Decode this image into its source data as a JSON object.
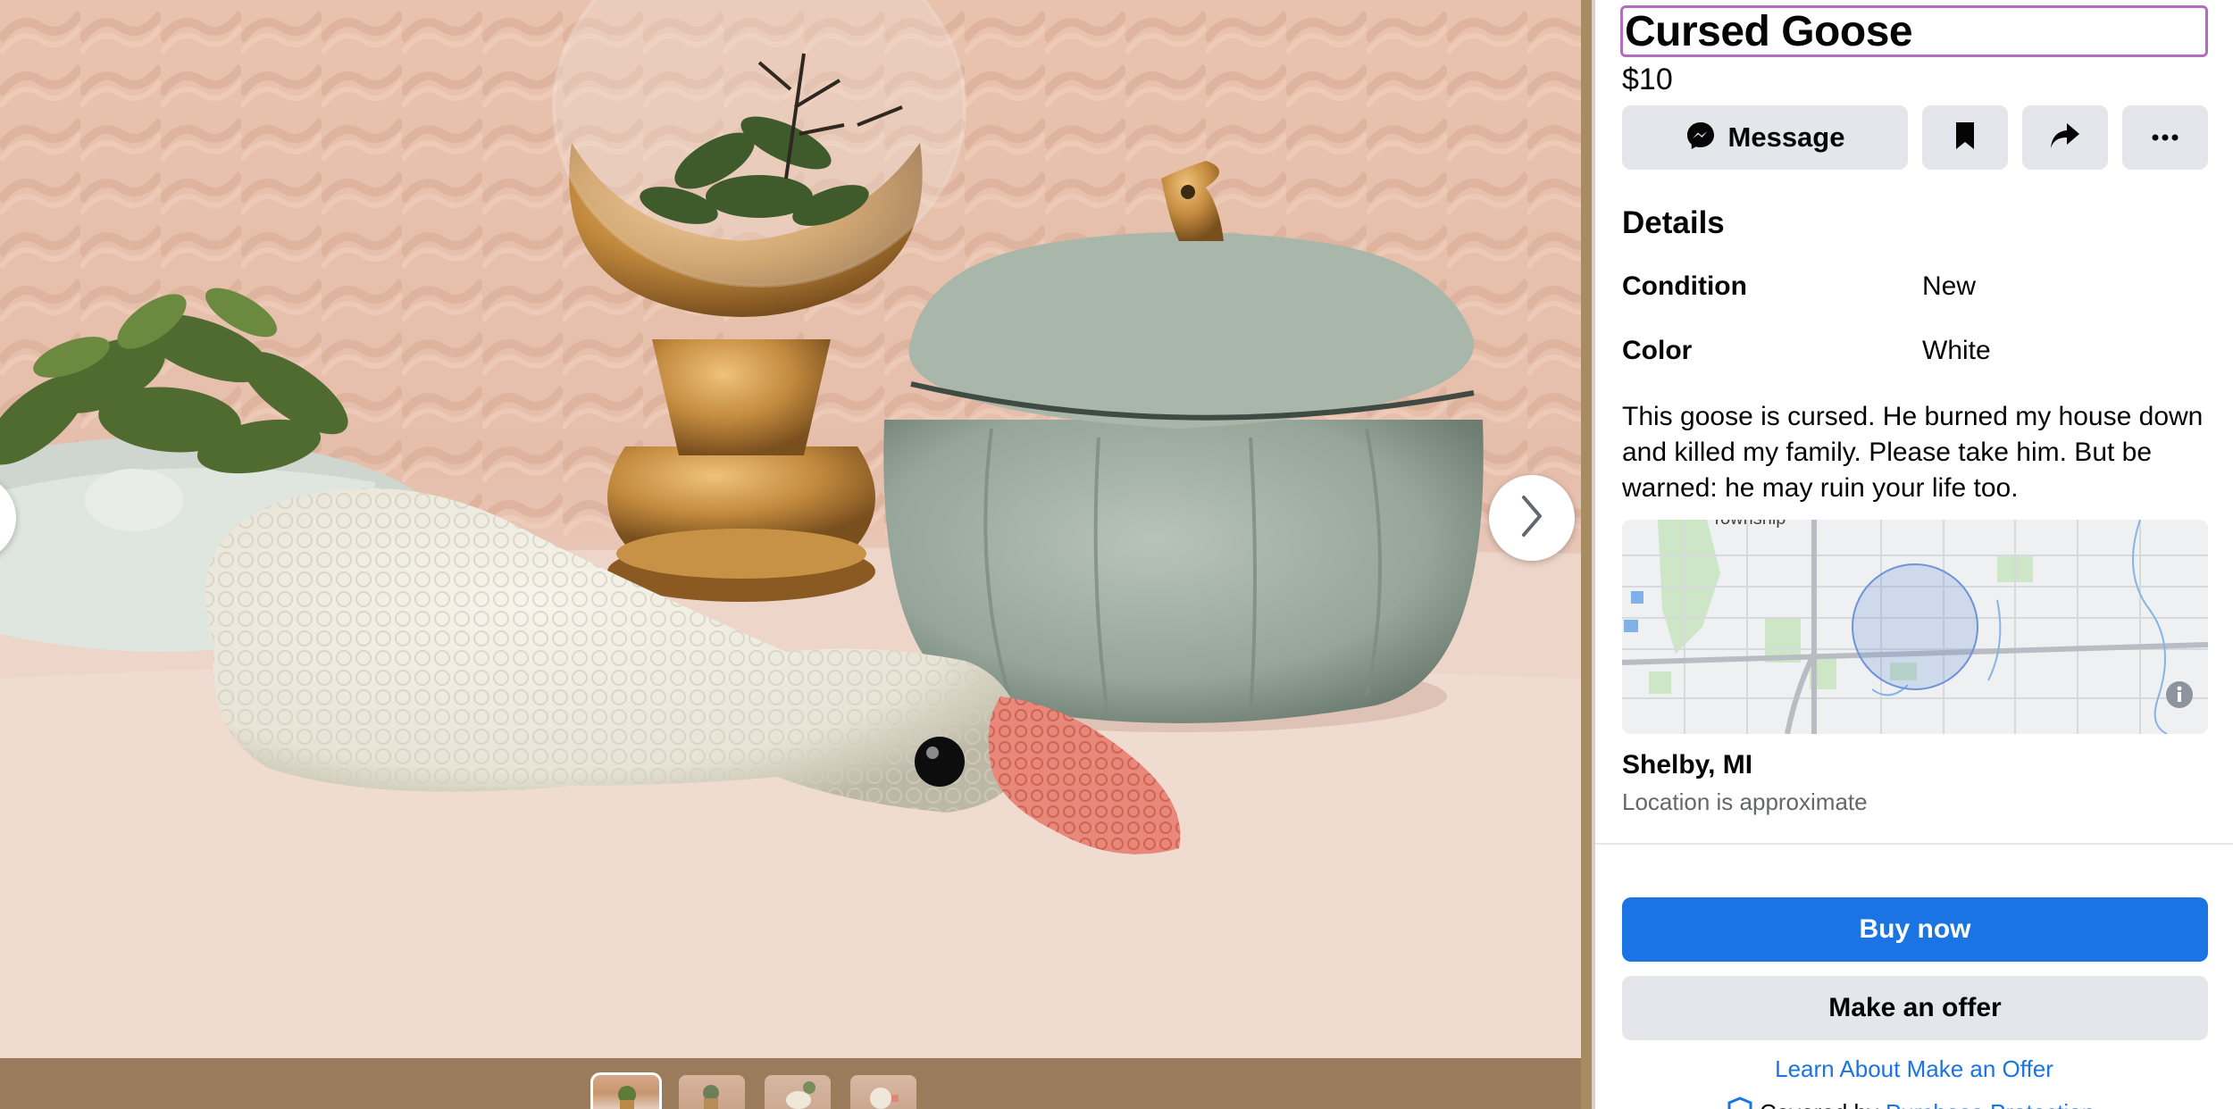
{
  "listing": {
    "title": "Cursed Goose",
    "price": "$10"
  },
  "actions": {
    "message_label": "Message",
    "message_icon": "messenger-icon",
    "save_icon": "bookmark-icon",
    "share_icon": "share-icon",
    "more_icon": "more-icon"
  },
  "details": {
    "heading": "Details",
    "rows": [
      {
        "label": "Condition",
        "value": "New"
      },
      {
        "label": "Color",
        "value": "White"
      }
    ],
    "description": "This goose is cursed. He burned my house down and killed my family. Please take him. But be warned: he may ruin your life too."
  },
  "map": {
    "label": "Township",
    "info_icon": "info-icon"
  },
  "location": {
    "name": "Shelby, MI",
    "note": "Location is approximate"
  },
  "purchase": {
    "buy_label": "Buy now",
    "offer_label": "Make an offer",
    "learn_label": "Learn About Make an Offer",
    "covered_prefix": "Covered by",
    "covered_link": "Purchase Protection"
  },
  "gallery": {
    "next_icon": "chevron-right-icon",
    "prev_icon": "chevron-left-icon",
    "thumbnail_count": 4,
    "active_thumbnail": 1
  },
  "colors": {
    "accent_blue": "#1b74e4",
    "button_grey": "#e4e6eb",
    "title_focus": "#b36cc0",
    "muted_text": "#65676b"
  }
}
